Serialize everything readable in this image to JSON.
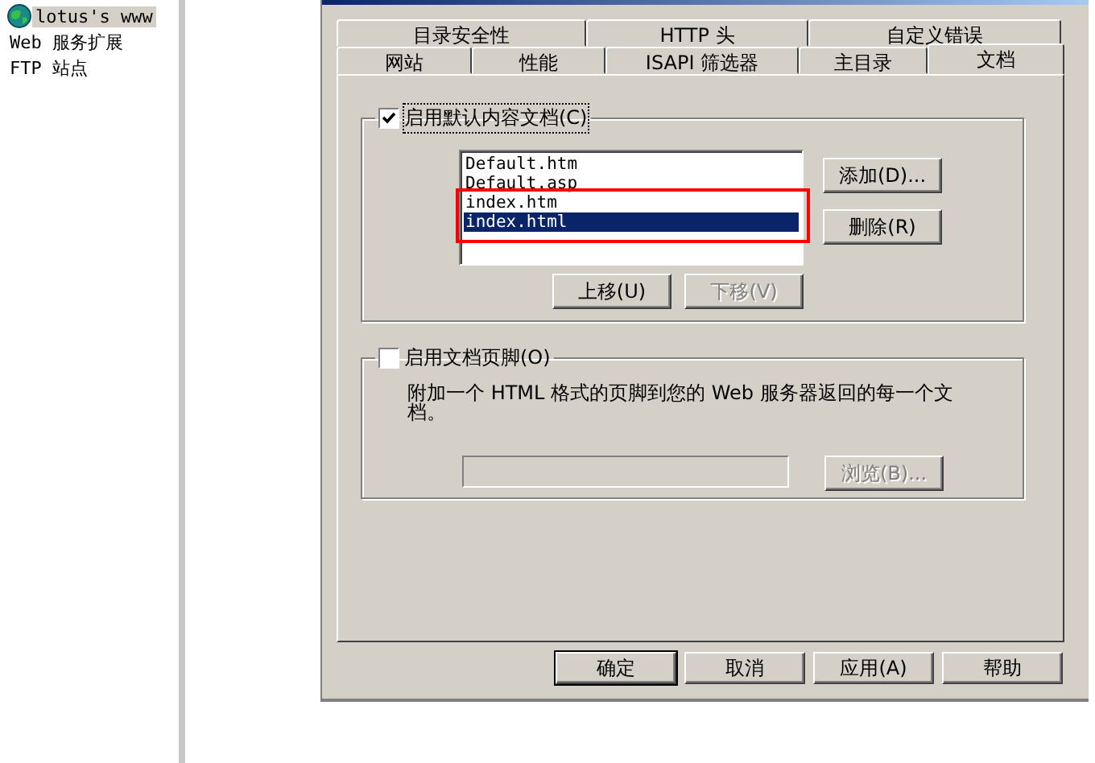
{
  "tree": {
    "items": [
      {
        "label": "lotus's www",
        "selected": true,
        "icon": true
      },
      {
        "label": "Web 服务扩展",
        "selected": false
      },
      {
        "label": "FTP 站点",
        "selected": false
      }
    ]
  },
  "dialog": {
    "tab_rows": [
      [
        {
          "label": "目录安全性",
          "selected": false
        },
        {
          "label": "HTTP 头",
          "selected": false
        },
        {
          "label": "自定义错误",
          "selected": false
        }
      ],
      [
        {
          "label": "网站",
          "selected": false
        },
        {
          "label": "性能",
          "selected": false
        },
        {
          "label": "ISAPI 筛选器",
          "selected": false
        },
        {
          "label": "主目录",
          "selected": false
        },
        {
          "label": "文档",
          "selected": true
        }
      ]
    ],
    "default_document": {
      "label": "启用默认内容文档(C)",
      "checked": true,
      "files": [
        {
          "label": "Default.htm",
          "selected": false
        },
        {
          "label": "Default.asp",
          "selected": false
        },
        {
          "label": "index.htm",
          "selected": false
        },
        {
          "label": "index.html",
          "selected": true
        }
      ],
      "side_buttons": [
        {
          "label": "添加(D)...",
          "disabled": false
        },
        {
          "label": "删除(R)",
          "disabled": false
        }
      ],
      "move_buttons": [
        {
          "label": "上移(U)",
          "disabled": false
        },
        {
          "label": "下移(V)",
          "disabled": true
        }
      ]
    },
    "footer": {
      "label": "启用文档页脚(O)",
      "checked": false,
      "description": "附加一个 HTML 格式的页脚到您的 Web 服务器返回的每一个文档。",
      "browse_button": {
        "label": "浏览(B)...",
        "disabled": true
      }
    },
    "buttons": [
      {
        "label": "确定",
        "default": true
      },
      {
        "label": "取消",
        "default": false
      },
      {
        "label": "应用(A)",
        "default": false
      },
      {
        "label": "帮助",
        "default": false
      }
    ]
  }
}
